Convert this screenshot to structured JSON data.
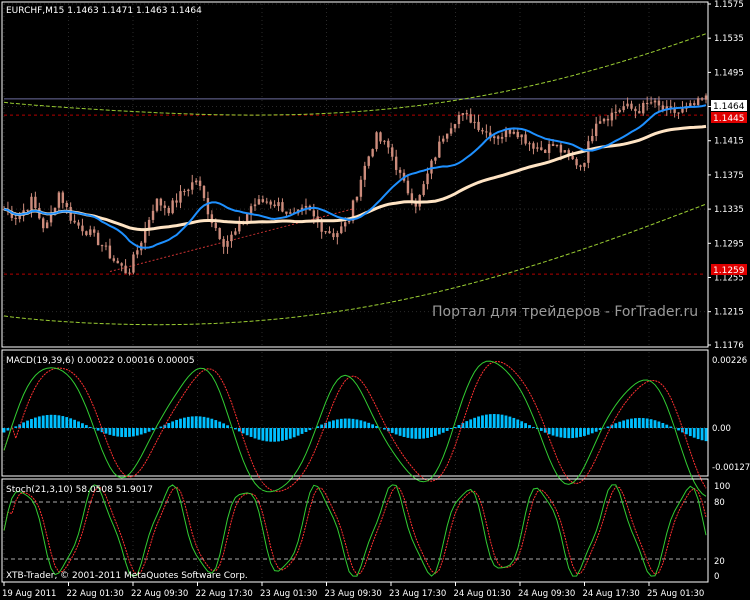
{
  "panels": {
    "main": {
      "title": "EURCHF,M15  1.1463 1.1471 1.1463 1.1464",
      "price_labels": [
        "1.1575",
        "1.1535",
        "1.1495",
        "1.1455",
        "1.1415",
        "1.1375",
        "1.1335",
        "1.1295",
        "1.1255",
        "1.1215",
        "1.1176"
      ],
      "current_price": "1.1464",
      "red_line_label": "1.1445",
      "lower_red_label": "1.1259",
      "watermark": "Портал для трейдеров - ForTrader.ru"
    },
    "macd": {
      "title": "MACD(19,39,6) 0.00022 0.00016 0.00005",
      "labels": [
        "0.00226",
        "0.00",
        "-0.00127"
      ]
    },
    "stoch": {
      "title": "Stoch(21,3,10) 58.0508 51.9017",
      "labels": [
        "100",
        "80",
        "20",
        "0"
      ],
      "copyright": "XTB-Trader, © 2001-2011 MetaQuotes Software Corp."
    }
  },
  "time_axis": [
    "19 Aug 2011",
    "22 Aug 01:30",
    "22 Aug 09:30",
    "22 Aug 17:30",
    "23 Aug 01:30",
    "23 Aug 09:30",
    "23 Aug 17:30",
    "24 Aug 01:30",
    "24 Aug 09:30",
    "24 Aug 17:30",
    "25 Aug 01:30"
  ],
  "colors": {
    "background": "#000000",
    "grid": "#2a2a2a",
    "candle_body": "#cd8c7c",
    "ma_fast": "#1e90ff",
    "ma_slow": "#ffe4c4",
    "envelope": "#9acd32",
    "macd_hist": "#00bfff",
    "macd_signal": "#ff3030",
    "stoch_main": "#32cd32",
    "stoch_signal": "#ff3030",
    "red_label_bg": "#e00000"
  },
  "chart_data": {
    "type": "line",
    "symbol": "EURCHF",
    "timeframe": "M15",
    "ohlc_last": {
      "open": 1.1463,
      "high": 1.1471,
      "low": 1.1463,
      "close": 1.1464
    },
    "indicators": {
      "macd": {
        "params": [
          19,
          39,
          6
        ],
        "values": [
          0.00022,
          0.00016,
          5e-05
        ]
      },
      "stoch": {
        "params": [
          21,
          3,
          10
        ],
        "main": 58.0508,
        "signal": 51.9017
      },
      "stoch_levels": [
        20,
        80
      ]
    },
    "price_range": [
      1.1176,
      1.1575
    ],
    "close_series": [
      1.1335,
      1.1325,
      1.1345,
      1.131,
      1.1355,
      1.132,
      1.131,
      1.1295,
      1.1275,
      1.126,
      1.13,
      1.1345,
      1.1335,
      1.1355,
      1.137,
      1.1325,
      1.1295,
      1.131,
      1.134,
      1.1345,
      1.134,
      1.1325,
      1.1335,
      1.1315,
      1.1305,
      1.132,
      1.1375,
      1.142,
      1.1405,
      1.1365,
      1.134,
      1.1385,
      1.1425,
      1.1445,
      1.144,
      1.1425,
      1.142,
      1.143,
      1.1415,
      1.1405,
      1.141,
      1.1395,
      1.1385,
      1.144,
      1.1445,
      1.1455,
      1.145,
      1.146,
      1.145,
      1.1448,
      1.1455,
      1.1464
    ]
  }
}
